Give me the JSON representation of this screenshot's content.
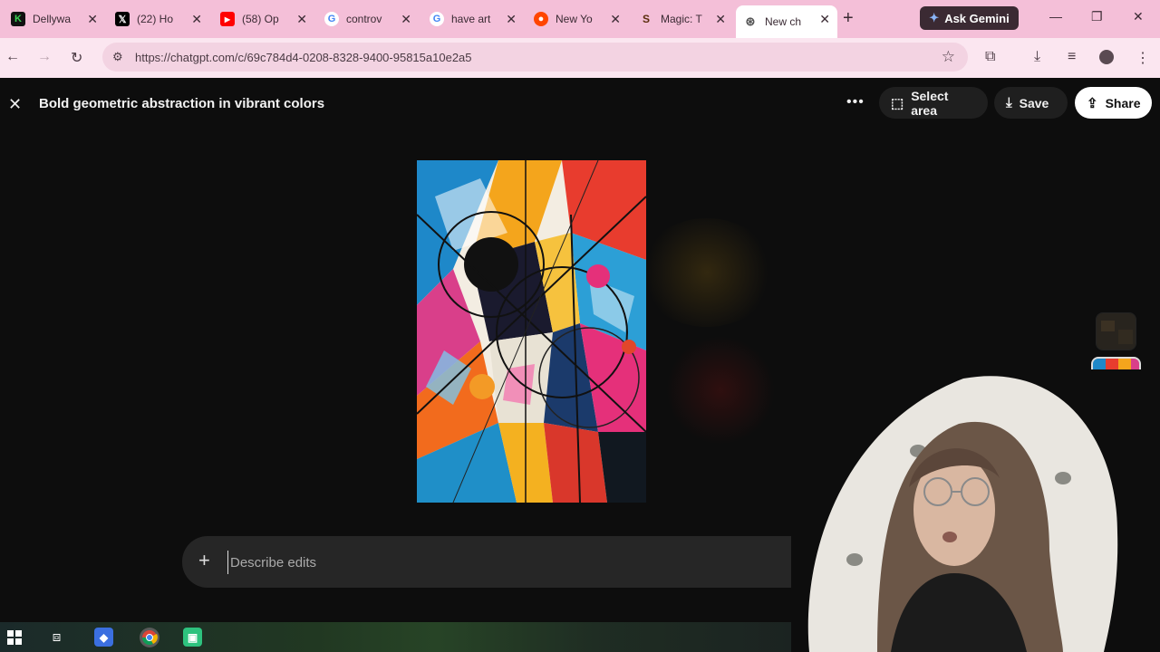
{
  "browser": {
    "tabs": [
      {
        "title": "Dellywa",
        "icon": "dellywa-k-icon",
        "color": "#2ea043"
      },
      {
        "title": "(22) Ho",
        "icon": "x-logo-icon",
        "color": "#000000"
      },
      {
        "title": "(58) Op",
        "icon": "youtube-icon",
        "color": "#ff0000"
      },
      {
        "title": "controv",
        "icon": "google-icon",
        "color": "#4285f4"
      },
      {
        "title": "have art",
        "icon": "google-icon",
        "color": "#4285f4"
      },
      {
        "title": "New Yo",
        "icon": "reddit-icon",
        "color": "#ff4500"
      },
      {
        "title": "Magic: T",
        "icon": "scryfall-icon",
        "color": "#5a2d0c"
      },
      {
        "title": "New ch",
        "icon": "chatgpt-icon",
        "color": "#555555",
        "active": true
      }
    ],
    "ask_gemini": "Ask Gemini",
    "url": "https://chatgpt.com/c/69c784d4-0208-8328-9400-95815a10e2a5"
  },
  "editor": {
    "title": "Bold geometric abstraction in vibrant colors",
    "select_area": "Select area",
    "save": "Save",
    "share": "Share",
    "input_placeholder": "Describe edits"
  }
}
